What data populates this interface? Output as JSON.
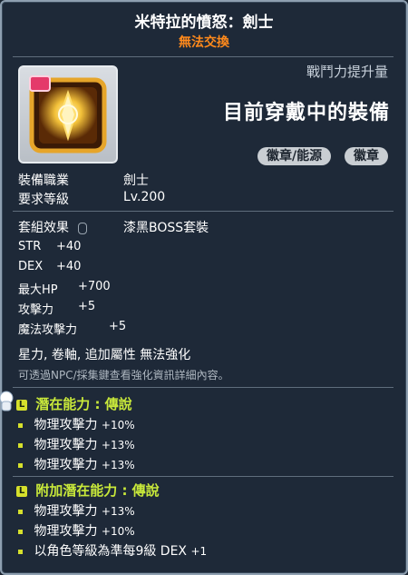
{
  "item": {
    "name": "米特拉的憤怒：劍士",
    "tradable": "無法交換",
    "power_label": "戰鬥力提升量",
    "current_equip": "目前穿戴中的裝備",
    "tags": [
      "徽章/能源",
      "徽章"
    ]
  },
  "info": {
    "job_label": "裝備職業",
    "job_value": "劍士",
    "level_label": "要求等級",
    "level_value": "Lv.200",
    "set_label": "套組效果",
    "set_value": "漆黑BOSS套裝"
  },
  "stats": [
    {
      "name": "STR",
      "value": "+40"
    },
    {
      "name": "DEX",
      "value": "+40"
    },
    {
      "name": "最大HP",
      "value": "+700"
    },
    {
      "name": "攻擊力",
      "value": "+5"
    },
    {
      "name": "魔法攻擊力",
      "value": "+5"
    }
  ],
  "notes": {
    "flags": "星力, 卷軸, 追加屬性 無法強化",
    "hint": "可透過NPC/採集鍵查看強化資訊詳細內容。"
  },
  "potential": {
    "header": "潛在能力 : 傳說",
    "lines": [
      {
        "name": "物理攻擊力",
        "value": "+10%"
      },
      {
        "name": "物理攻擊力",
        "value": "+13%"
      },
      {
        "name": "物理攻擊力",
        "value": "+13%"
      }
    ]
  },
  "additional": {
    "header": "附加潛在能力 : 傳說",
    "lines": [
      {
        "name": "物理攻擊力",
        "value": "+13%"
      },
      {
        "name": "物理攻擊力",
        "value": "+10%"
      },
      {
        "name": "以角色等級為準每9級 DEX",
        "value": "+1"
      }
    ]
  },
  "icon_letter": "L",
  "colors": {
    "legend": "#c8e83a",
    "orange": "#ff8a1c"
  }
}
